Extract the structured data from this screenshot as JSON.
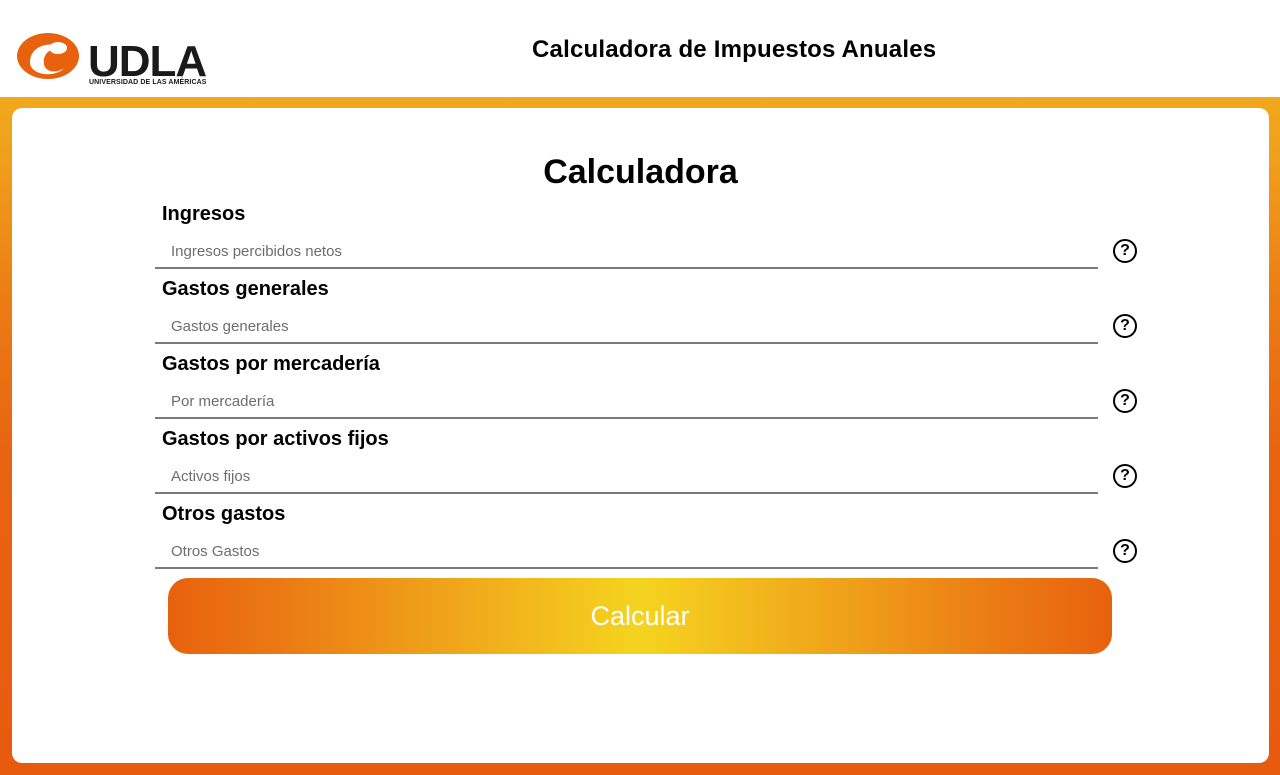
{
  "header": {
    "logo_text": "UDLA",
    "logo_subtext": "UNIVERSIDAD DE LAS AMÉRICAS",
    "title": "Calculadora de Impuestos Anuales"
  },
  "calculator": {
    "title": "Calculadora",
    "sections": [
      {
        "label": "Ingresos",
        "placeholder": "Ingresos percibidos netos",
        "help_icon": "question-circle-icon"
      },
      {
        "label": "Gastos generales",
        "placeholder": "Gastos generales",
        "help_icon": "question-circle-icon"
      },
      {
        "label": "Gastos por mercadería",
        "placeholder": "Por mercadería",
        "help_icon": "question-circle-icon"
      },
      {
        "label": "Gastos por activos fijos",
        "placeholder": "Activos fijos",
        "help_icon": "question-circle-icon"
      },
      {
        "label": "Otros gastos",
        "placeholder": "Otros Gastos",
        "help_icon": "question-circle-icon"
      }
    ],
    "help_symbol": "?",
    "submit_label": "Calcular"
  },
  "colors": {
    "brand_orange": "#e8610e",
    "brand_yellow": "#f5d41f",
    "field_border": "#7a7a7a"
  }
}
